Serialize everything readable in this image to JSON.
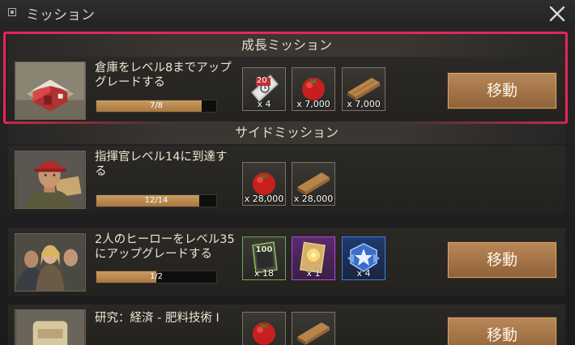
{
  "window": {
    "title": "ミッション"
  },
  "sections": {
    "growth_title": "成長ミッション",
    "side_title": "サイドミッション"
  },
  "growth": {
    "description": "倉庫をレベル8までアップグレードする",
    "progress_text": "7/8",
    "progress_fraction": 0.875,
    "rewards": [
      {
        "icon": "speedup-ticket-icon",
        "badge": "20",
        "qty": "x 4"
      },
      {
        "icon": "tomato-food-icon",
        "qty": "x 7,000"
      },
      {
        "icon": "wood-plank-icon",
        "qty": "x 7,000"
      }
    ],
    "button": "移動"
  },
  "side": [
    {
      "description": "指揮官レベル14に到達する",
      "progress_text": "12/14",
      "progress_fraction": 0.857,
      "rewards": [
        {
          "icon": "tomato-food-icon",
          "qty": "x 28,000"
        },
        {
          "icon": "wood-plank-icon",
          "qty": "x 28,000"
        }
      ]
    },
    {
      "description": "2人のヒーローをレベル35にアップグレードする",
      "progress_text": "1/2",
      "progress_fraction": 0.5,
      "rewards": [
        {
          "icon": "exp-book-icon",
          "badge": "100",
          "qty": "x 18"
        },
        {
          "icon": "hero-card-icon",
          "qty": "x 1"
        },
        {
          "icon": "rank-medal-icon",
          "qty": "x 4"
        }
      ],
      "button": "移動"
    },
    {
      "description": "研究：経済 - 肥料技術 I",
      "rewards": [
        {
          "icon": "tomato-food-icon"
        },
        {
          "icon": "wood-plank-icon"
        }
      ],
      "button": "移動"
    }
  ],
  "colors": {
    "highlight": "#e8245a",
    "button": "#a87a4a",
    "progress": "#c99b62"
  }
}
